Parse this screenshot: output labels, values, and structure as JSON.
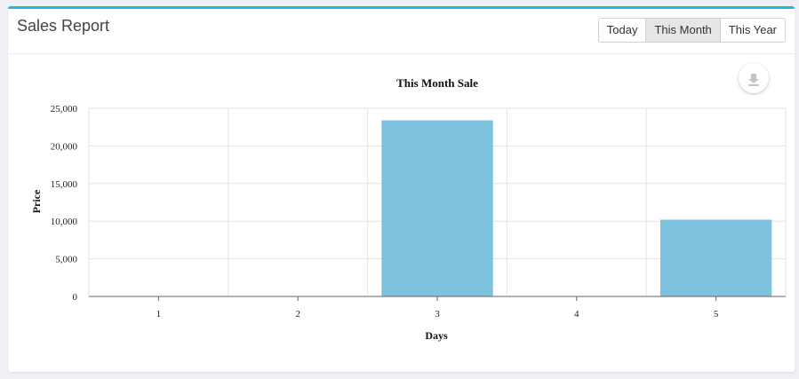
{
  "header": {
    "title": "Sales Report",
    "range_buttons": [
      {
        "label": "Today",
        "active": false
      },
      {
        "label": "This Month",
        "active": true
      },
      {
        "label": "This Year",
        "active": false
      }
    ]
  },
  "download_icon": "download-icon",
  "colors": {
    "accent": "#20b8e0",
    "bar": "#7ec3de"
  },
  "chart_data": {
    "type": "bar",
    "title": "This Month Sale",
    "xlabel": "Days",
    "ylabel": "Price",
    "categories": [
      "1",
      "2",
      "3",
      "4",
      "5"
    ],
    "values": [
      0,
      0,
      23400,
      0,
      10200
    ],
    "ylim": [
      0,
      25000
    ],
    "yticks": [
      0,
      5000,
      10000,
      15000,
      20000,
      25000
    ],
    "ytick_labels": [
      "0",
      "5,000",
      "10,000",
      "15,000",
      "20,000",
      "25,000"
    ],
    "grid": true,
    "legend": "none"
  }
}
